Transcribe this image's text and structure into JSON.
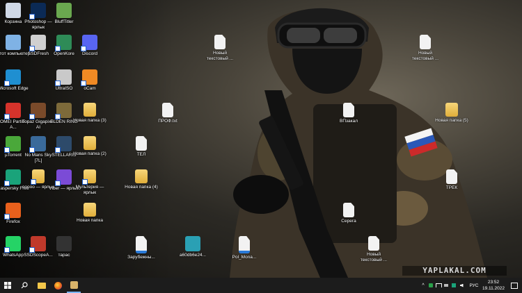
{
  "desktop": {
    "wallpaper": "soldier-wallpaper",
    "icons": [
      {
        "label": "Корзина",
        "icon": "recycle-bin-icon",
        "color": "#cfd8e6"
      },
      {
        "label": "Photoshop — ярлык",
        "icon": "photoshop-icon",
        "color": "#0b2a55"
      },
      {
        "label": "BluffTitler",
        "icon": "blufftitler-icon",
        "color": "#6aa84f"
      },
      {
        "label": "Этот компьютер",
        "icon": "this-pc-icon",
        "color": "#7fb2e5"
      },
      {
        "label": "SSDFresh",
        "icon": "ssdfresh-icon",
        "color": "#d0d0d0"
      },
      {
        "label": "OpenKore",
        "icon": "openkore-icon",
        "color": "#2e8b57"
      },
      {
        "label": "Discord",
        "icon": "discord-icon",
        "color": "#5865f2"
      },
      {
        "label": "Новый текстовый ...",
        "icon": "text-file-icon",
        "color": "#f2f2f2"
      },
      {
        "label": "Новый текстовый ...",
        "icon": "text-file-icon",
        "color": "#f2f2f2"
      },
      {
        "label": "Microsoft Edge",
        "icon": "edge-icon",
        "color": "#1f8fd1"
      },
      {
        "label": "UltraISO",
        "icon": "ultraiso-icon",
        "color": "#c9c9c9"
      },
      {
        "label": "oCam",
        "icon": "ocam-icon",
        "color": "#f08a24"
      },
      {
        "label": "AOMEI Partition A...",
        "icon": "aomei-icon",
        "color": "#d6332b"
      },
      {
        "label": "Topaz Gigapixel AI",
        "icon": "topaz-icon",
        "color": "#7a4a2a"
      },
      {
        "label": "ELDEN RING",
        "icon": "elden-ring-icon",
        "color": "#7d6a3a"
      },
      {
        "label": "Новая папка (3)",
        "icon": "folder-icon",
        "color": "#e8c25a"
      },
      {
        "label": "ПРОФ.txt",
        "icon": "text-file-icon",
        "color": "#f2f2f2"
      },
      {
        "label": "ВПзакал",
        "icon": "text-file-icon",
        "color": "#f2f2f2"
      },
      {
        "label": "Новая папка (5)",
        "icon": "folder-icon",
        "color": "#e8c25a"
      },
      {
        "label": "µTorrent",
        "icon": "utorrent-icon",
        "color": "#4aa83a"
      },
      {
        "label": "No Mans Sky [7L]",
        "icon": "no-mans-sky-icon",
        "color": "#3a6a9a"
      },
      {
        "label": "STELLARIS",
        "icon": "stellaris-icon",
        "color": "#2d4a6a"
      },
      {
        "label": "Новая папка (2)",
        "icon": "folder-icon",
        "color": "#e8c25a"
      },
      {
        "label": "ТЕЛ",
        "icon": "text-file-icon",
        "color": "#f2f2f2"
      },
      {
        "label": "Kaspersky Free",
        "icon": "kaspersky-icon",
        "color": "#1aa37a"
      },
      {
        "label": "ооооо — ярлык",
        "icon": "folder-shortcut-icon",
        "color": "#e8c25a"
      },
      {
        "label": "Viber — ярлык",
        "icon": "viber-icon",
        "color": "#7b4bd6"
      },
      {
        "label": "Мультерия — ярлык",
        "icon": "folder-shortcut-icon",
        "color": "#e8c25a"
      },
      {
        "label": "Новая папка (4)",
        "icon": "folder-icon",
        "color": "#e8c25a"
      },
      {
        "label": "ТРЕК",
        "icon": "text-file-icon",
        "color": "#f2f2f2"
      },
      {
        "label": "Firefox",
        "icon": "firefox-icon",
        "color": "#e8601c"
      },
      {
        "label": "Новая папка",
        "icon": "folder-icon",
        "color": "#e8c25a"
      },
      {
        "label": "Серега",
        "icon": "text-file-icon",
        "color": "#f2f2f2"
      },
      {
        "label": "WhatsApp",
        "icon": "whatsapp-icon",
        "color": "#25d366"
      },
      {
        "label": "SSDScopeA...",
        "icon": "ssdscope-icon",
        "color": "#c0392b"
      },
      {
        "label": "тарас",
        "icon": "video-file-icon",
        "color": "#333333"
      },
      {
        "label": "Зарубежны...",
        "icon": "mp3-file-icon",
        "color": "#f2f2f2"
      },
      {
        "label": "a60db6e24...",
        "icon": "image-file-icon",
        "color": "#2aa0b4"
      },
      {
        "label": "Pol_Mona...",
        "icon": "mp3-file-icon",
        "color": "#f2f2f2"
      },
      {
        "label": "Новый текстовый ...",
        "icon": "text-file-icon",
        "color": "#f2f2f2"
      }
    ]
  },
  "watermark": "YAPLAKAL.COM",
  "taskbar": {
    "start_icon": "windows-start-icon",
    "search_icon": "search-icon",
    "pinned": [
      {
        "icon": "file-explorer-icon",
        "color": "#f3c74a"
      },
      {
        "icon": "firefox-icon",
        "color": "#e8601c"
      },
      {
        "icon": "photo-app-icon",
        "color": "#d9b36a"
      }
    ],
    "tray": {
      "language": "РУС",
      "time": "23:52",
      "date": "19.11.2022"
    }
  }
}
